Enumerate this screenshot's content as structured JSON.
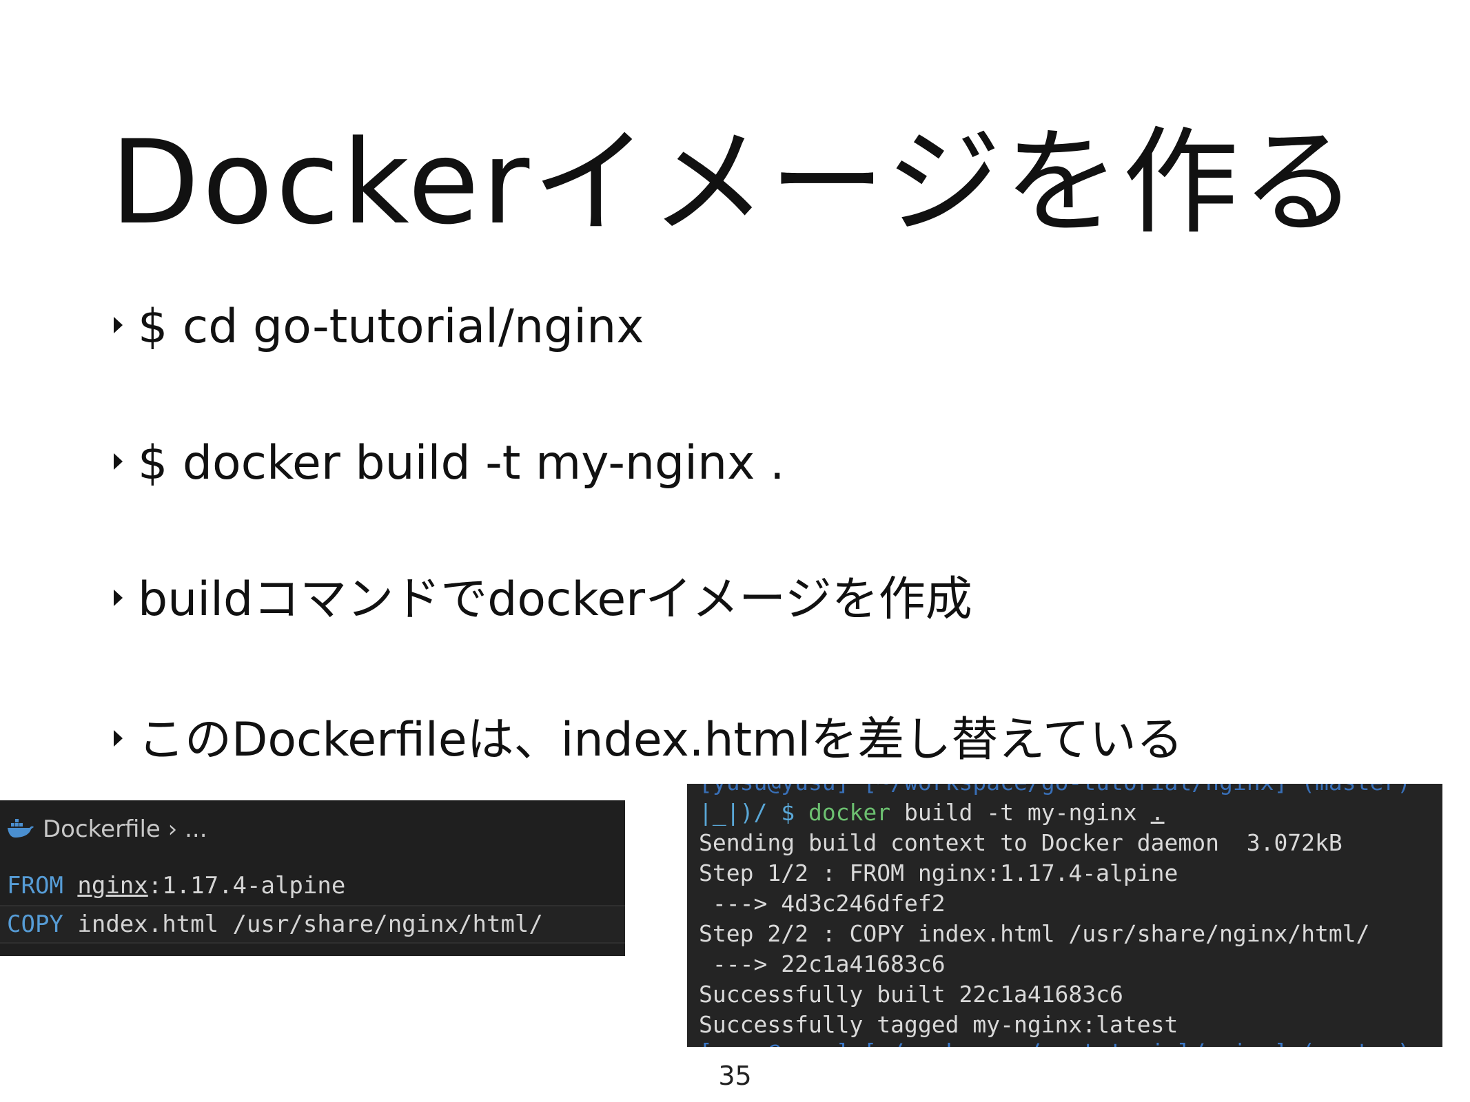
{
  "slide": {
    "title": "Dockerイメージを作る",
    "page_number": "35"
  },
  "bullets": [
    "$ cd go-tutorial/nginx",
    "$ docker build -t my-nginx .",
    "buildコマンドでdockerイメージを作成",
    "このDockerfileは、index.htmlを差し替えている"
  ],
  "editor": {
    "breadcrumb_file": "Dockerfile",
    "breadcrumb_sep": "›",
    "breadcrumb_rest": "...",
    "icon": "docker-whale-icon",
    "lines": [
      {
        "keyword": "FROM",
        "arg_main": "nginx",
        "arg_rest": ":1.17.4-alpine"
      },
      {
        "keyword": "COPY",
        "arg_main": "index.html /usr/share/nginx/html/",
        "arg_rest": ""
      }
    ],
    "colors": {
      "background": "#1f1f1f",
      "keyword": "#569cd6",
      "text": "#d4d4d4"
    }
  },
  "terminal": {
    "top_partial": "[yusu@yusu] [~/workspace/go-tutorial/nginx] (master)",
    "prompt_prefix": "|_|)/ $ ",
    "prompt_cmd": "docker",
    "prompt_args": " build -t my-nginx ",
    "prompt_dot": ".",
    "output": [
      "Sending build context to Docker daemon  3.072kB",
      "Step 1/2 : FROM nginx:1.17.4-alpine",
      " ---> 4d3c246dfef2",
      "Step 2/2 : COPY index.html /usr/share/nginx/html/",
      " ---> 22c1a41683c6",
      "Successfully built 22c1a41683c6",
      "Successfully tagged my-nginx:latest"
    ],
    "bottom_partial": "[yusu@yusu] [~/workspace/go-tutorial/nginx] (master)",
    "colors": {
      "background": "#242424",
      "command": "#6cc070",
      "path": "#3b78c8"
    }
  }
}
